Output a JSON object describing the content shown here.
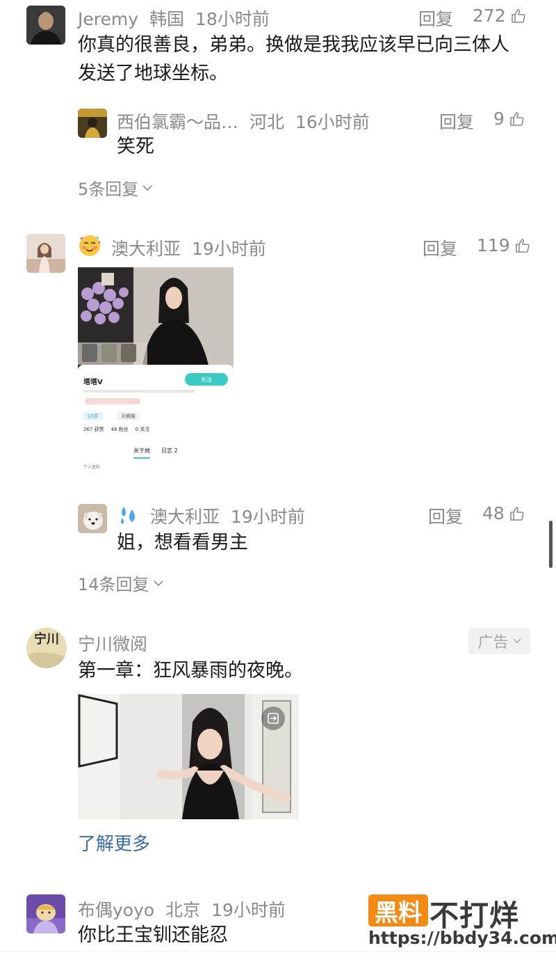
{
  "comments": [
    {
      "user": "Jeremy",
      "location": "韩国",
      "time": "18小时前",
      "reply_label": "回复",
      "likes": "272",
      "text_line1": "你真的很善良，弟弟。换做是我我应该早已向三体人",
      "text_line2": "发送了地球坐标。",
      "sub_reply": {
        "user": "西伯氯霸～品…",
        "location": "河北",
        "time": "16小时前",
        "reply_label": "回复",
        "likes": "9",
        "text": "笑死"
      },
      "more_replies": "5条回复"
    },
    {
      "user": "澳大利亚",
      "time": "19小时前",
      "reply_label": "回复",
      "likes": "119",
      "screenshot": {
        "profile_name": "塔塔V",
        "follow_label": "关注",
        "stats": [
          "267 获赞",
          "48 粉丝",
          "0 关注"
        ],
        "tabs": [
          "关于她",
          "日志 2"
        ],
        "tag1": "13岁",
        "tag2": "天蝎座",
        "note": "个人资料"
      },
      "sub_reply": {
        "user": "澳大利亚",
        "time": "19小时前",
        "reply_label": "回复",
        "likes": "48",
        "text": "姐，想看看男主"
      },
      "more_replies": "14条回复"
    },
    {
      "user": "宁川微阅",
      "avatar_text": "宁川",
      "ad_label": "广告",
      "text": "第一章：狂风暴雨的夜晚。",
      "learn_more": "了解更多"
    },
    {
      "user": "布偶yoyo",
      "location": "北京",
      "time": "19小时前",
      "text": "你比王宝钏还能忍"
    }
  ],
  "watermark": {
    "badge": "黑料",
    "text": "不打烊",
    "url": "https://bbdy34.com"
  },
  "icons": {
    "thumb": "thumb-up-icon",
    "chevron": "chevron-down-icon",
    "exit": "exit-icon"
  },
  "colors": {
    "meta": "#8a8a8a",
    "link": "#3c6aa8",
    "watermark_orange": "#f28a13",
    "follow_teal": "#3ccbc4"
  }
}
